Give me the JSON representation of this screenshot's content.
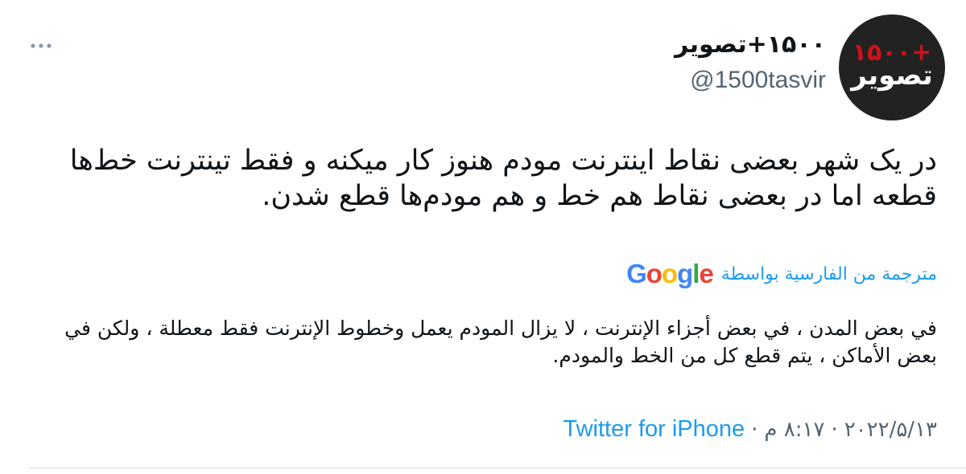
{
  "author": {
    "display_name": "۱۵۰۰+تصویر",
    "handle": "@1500tasvir",
    "avatar": {
      "mark_text": "۱۵۰۰+",
      "word_text": "تصویر",
      "background": "#222222",
      "mark_color": "#d0101a"
    }
  },
  "more_icon": "more-dots-icon",
  "tweet": {
    "text": "در یک شهر بعضی نقاط اینترنت مودم هنوز کار میکنه و فقط تینترنت خط‌ها قطعه اما در بعضی نقاط هم خط و هم مودم‌ها قطع شدن."
  },
  "translation": {
    "label": "مترجمة من الفارسية بواسطة",
    "provider": "Google",
    "provider_colors": [
      "#4285F4",
      "#EA4335",
      "#FBBC05",
      "#4285F4",
      "#34A853",
      "#EA4335"
    ],
    "text": "في بعض المدن ، في بعض أجزاء الإنترنت ، لا يزال المودم يعمل وخطوط الإنترنت فقط معطلة ، ولكن في بعض الأماكن ، يتم قطع كل من الخط والمودم."
  },
  "meta": {
    "date": "۲۰۲۲/۵/۱۳",
    "time": "۸:۱۷ م",
    "separator": "·",
    "source": "Twitter for iPhone"
  },
  "colors": {
    "text": "#0f1419",
    "secondary": "#536471",
    "link": "#1d9bf0",
    "divider": "#cfd9de"
  }
}
